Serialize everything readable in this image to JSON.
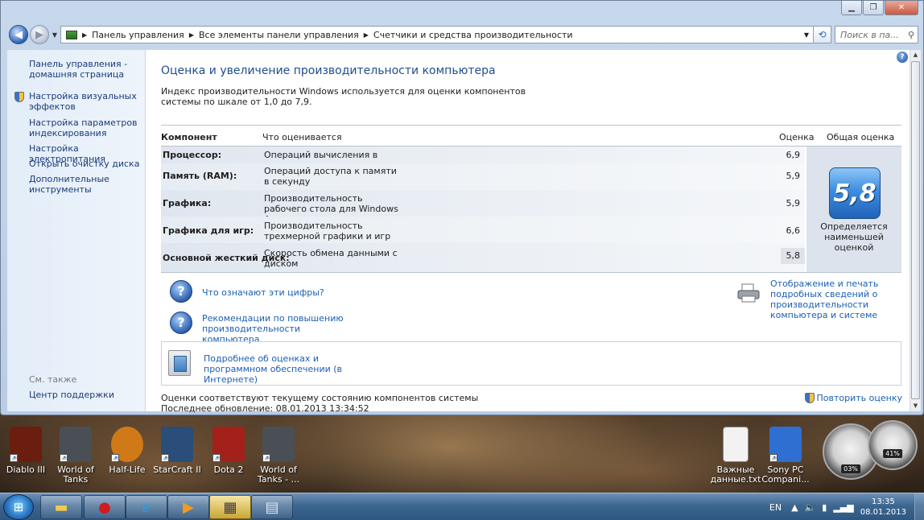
{
  "window": {
    "breadcrumb": [
      "Панель управления",
      "Все элементы панели управления",
      "Счетчики и средства производительности"
    ],
    "search_placeholder": "Поиск в па..."
  },
  "sidebar": {
    "links": [
      "Панель управления - домашняя страница",
      "Настройка визуальных эффектов",
      "Настройка параметров индексирования",
      "Настройка электропитания",
      "Открыть очистку диска",
      "Дополнительные инструменты"
    ],
    "see_also_title": "См. также",
    "see_also_link": "Центр поддержки"
  },
  "main": {
    "title": "Оценка и увеличение производительности компьютера",
    "intro": "Индекс производительности Windows используется для оценки компонентов системы по шкале от 1,0 до 7,9.",
    "table": {
      "headers": {
        "component": "Компонент",
        "what": "Что оценивается",
        "score": "Оценка",
        "overall": "Общая оценка"
      },
      "rows": [
        {
          "name": "Процессор:",
          "what": "Операций вычисления в секунду",
          "score": "6,9"
        },
        {
          "name": "Память (RAM):",
          "what": "Операций доступа к памяти в секунду",
          "score": "5,9"
        },
        {
          "name": "Графика:",
          "what": "Производительность рабочего стола для Windows Aero",
          "score": "5,9"
        },
        {
          "name": "Графика для игр:",
          "what": "Производительность трехмерной графики и игр",
          "score": "6,6"
        },
        {
          "name": "Основной жесткий диск:",
          "what": "Скорость обмена данными с диском",
          "score": "5,8"
        }
      ],
      "overall_score": "5,8",
      "overall_caption": "Определяется наименьшей оценкой"
    },
    "links": {
      "what_numbers": "Что означают эти цифры?",
      "recommendations": "Рекомендации по повышению производительности компьютера.",
      "print_details": "Отображение и печать подробных сведений о производительности компьютера и системе",
      "more_online": "Подробнее об оценках и программном обеспечении (в Интернете)"
    },
    "status_line": "Оценки соответствуют текущему состоянию компонентов системы",
    "last_update": "Последнее обновление: 08.01.2013 13:34:52",
    "repeat_label": "Повторить оценку"
  },
  "desktop": {
    "icons": [
      {
        "label": "Diablo III",
        "color": "#6b1d0f"
      },
      {
        "label": "World of Tanks",
        "color": "#4a4f55"
      },
      {
        "label": "Half-Life",
        "color": "#d07a17"
      },
      {
        "label": "StarCraft II",
        "color": "#2a4d7a"
      },
      {
        "label": "Dota 2",
        "color": "#a3211a"
      },
      {
        "label": "World of Tanks - ...",
        "color": "#4a4f55"
      },
      {
        "label": "Важные данные.txt",
        "color": "#f2f2f2"
      },
      {
        "label": "Sony PC Compani...",
        "color": "#2e6fd1"
      }
    ],
    "gadget_cpu": "03%",
    "gadget_mem": "41%"
  },
  "taskbar": {
    "lang": "EN",
    "time": "13:35",
    "date": "08.01.2013"
  }
}
